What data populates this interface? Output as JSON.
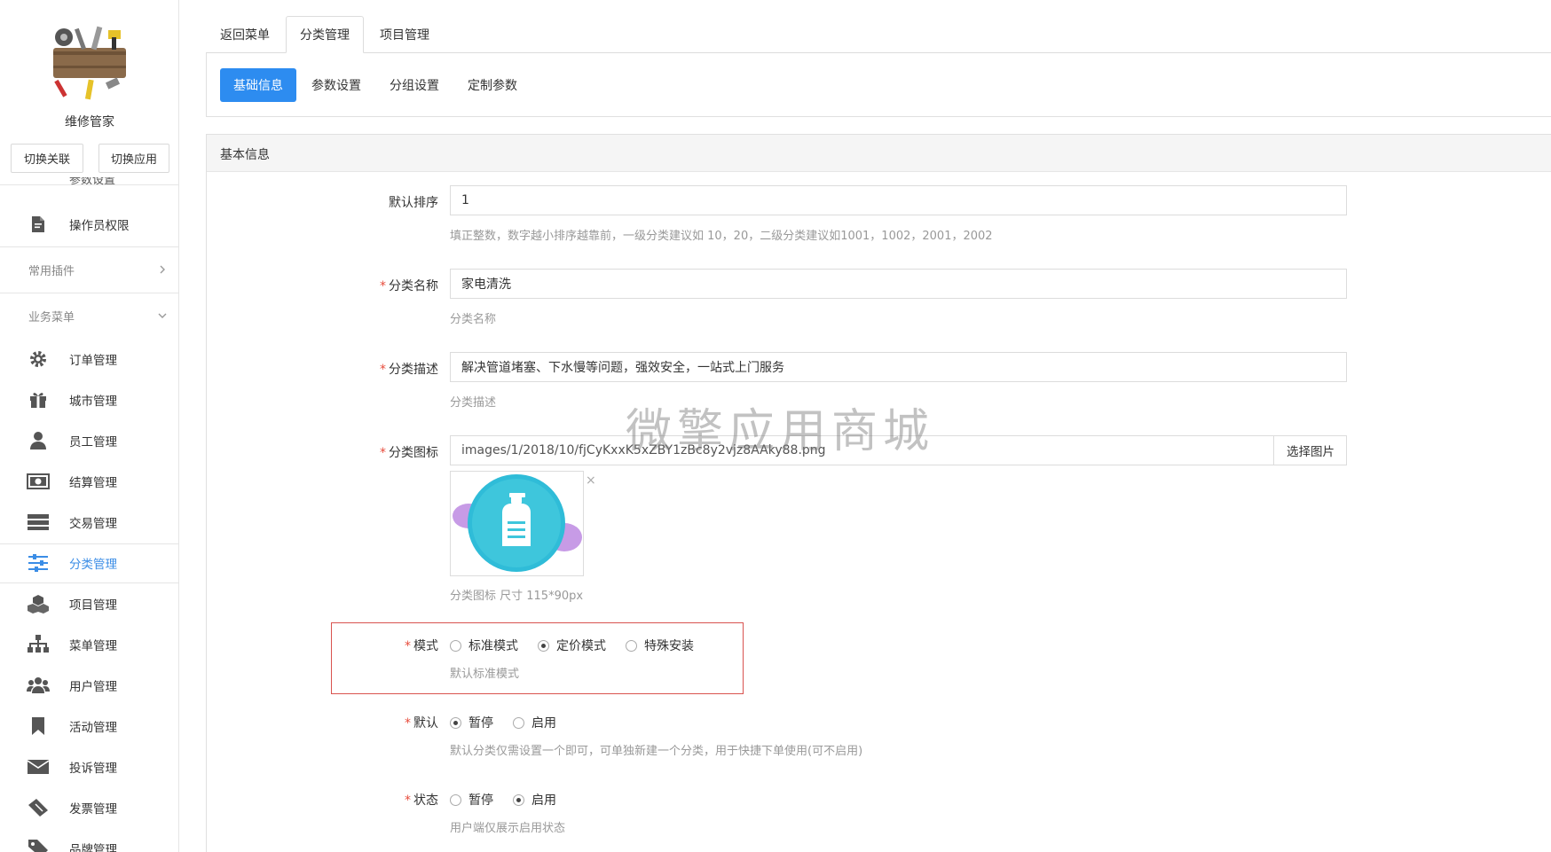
{
  "sidebar": {
    "app_name": "维修管家",
    "switch_link_label": "切换关联",
    "switch_app_label": "切换应用",
    "cut_item_label": "参数设置",
    "operator_perm_label": "操作员权限",
    "group_plugins_label": "常用插件",
    "group_business_label": "业务菜单",
    "items": [
      {
        "label": "订单管理",
        "icon": "gear-icon"
      },
      {
        "label": "城市管理",
        "icon": "gift-icon"
      },
      {
        "label": "员工管理",
        "icon": "user-icon"
      },
      {
        "label": "结算管理",
        "icon": "money-icon"
      },
      {
        "label": "交易管理",
        "icon": "server-icon"
      },
      {
        "label": "分类管理",
        "icon": "sliders-icon",
        "active": true
      },
      {
        "label": "项目管理",
        "icon": "cubes-icon"
      },
      {
        "label": "菜单管理",
        "icon": "sitemap-icon"
      },
      {
        "label": "用户管理",
        "icon": "users-icon"
      },
      {
        "label": "活动管理",
        "icon": "bookmark-icon"
      },
      {
        "label": "投诉管理",
        "icon": "envelope-icon"
      },
      {
        "label": "发票管理",
        "icon": "ticket-icon"
      },
      {
        "label": "品牌管理",
        "icon": "tag-icon"
      }
    ]
  },
  "top_tabs": [
    {
      "label": "返回菜单"
    },
    {
      "label": "分类管理",
      "active": true
    },
    {
      "label": "项目管理"
    }
  ],
  "sub_tabs": [
    {
      "label": "基础信息",
      "active": true
    },
    {
      "label": "参数设置"
    },
    {
      "label": "分组设置"
    },
    {
      "label": "定制参数"
    }
  ],
  "panel": {
    "title": "基本信息",
    "fields": {
      "sort": {
        "label": "默认排序",
        "value": "1",
        "help": "填正整数，数字越小排序越靠前，一级分类建议如 10，20，二级分类建议如1001，1002，2001，2002"
      },
      "name": {
        "label": "分类名称",
        "value": "家电清洗",
        "help": "分类名称"
      },
      "desc": {
        "label": "分类描述",
        "value": "解决管道堵塞、下水慢等问题，强效安全，一站式上门服务",
        "help": "分类描述"
      },
      "icon": {
        "label": "分类图标",
        "value": "images/1/2018/10/fjCyKxxK5xZBY1zBc8y2vjz8AAky88.png",
        "button": "选择图片",
        "help": "分类图标 尺寸 115*90px",
        "close_glyph": "×"
      },
      "mode": {
        "label": "模式",
        "options": [
          "标准模式",
          "定价模式",
          "特殊安装"
        ],
        "selected": 1,
        "help": "默认标准模式"
      },
      "default": {
        "label": "默认",
        "options": [
          "暂停",
          "启用"
        ],
        "selected": 0,
        "help": "默认分类仅需设置一个即可，可单独新建一个分类，用于快捷下单使用(可不启用)"
      },
      "status": {
        "label": "状态",
        "options": [
          "暂停",
          "启用"
        ],
        "selected": 1,
        "help": "用户端仅展示启用状态"
      }
    }
  },
  "watermark": "微擎应用商城",
  "colors": {
    "primary": "#2d8cf0",
    "required": "#e74c3c",
    "highlight_border": "#d9534f",
    "active_nav": "#3b8de6"
  }
}
